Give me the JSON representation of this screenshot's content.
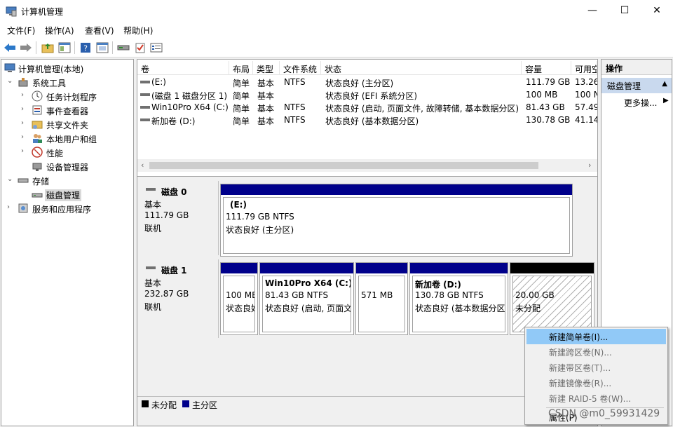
{
  "window": {
    "title": "计算机管理",
    "buttons": {
      "minimize": "—",
      "maximize": "☐",
      "close": "✕"
    }
  },
  "menu": [
    "文件(F)",
    "操作(A)",
    "查看(V)",
    "帮助(H)"
  ],
  "toolbar": {
    "icons": [
      "back-arrow-icon",
      "forward-arrow-icon",
      "up-folder-icon",
      "show-tree-icon",
      "help-icon",
      "console-icon",
      "connect-icon",
      "check-icon",
      "properties-icon"
    ]
  },
  "tree": {
    "root": "计算机管理(本地)",
    "system_tools": "系统工具",
    "task_scheduler": "任务计划程序",
    "event_viewer": "事件查看器",
    "shared_folders": "共享文件夹",
    "local_users": "本地用户和组",
    "performance": "性能",
    "device_manager": "设备管理器",
    "storage": "存储",
    "disk_management": "磁盘管理",
    "services": "服务和应用程序"
  },
  "volumes": {
    "headers": [
      "卷",
      "布局",
      "类型",
      "文件系统",
      "状态",
      "容量",
      "可用空"
    ],
    "rows": [
      {
        "name": "(E:)",
        "layout": "简单",
        "type": "基本",
        "fs": "NTFS",
        "status": "状态良好 (主分区)",
        "capacity": "111.79 GB",
        "free": "13.26"
      },
      {
        "name": "(磁盘 1 磁盘分区 1)",
        "layout": "简单",
        "type": "基本",
        "fs": "",
        "status": "状态良好 (EFI 系统分区)",
        "capacity": "100 MB",
        "free": "100 N"
      },
      {
        "name": "Win10Pro X64 (C:)",
        "layout": "简单",
        "type": "基本",
        "fs": "NTFS",
        "status": "状态良好 (启动, 页面文件, 故障转储, 基本数据分区)",
        "capacity": "81.43 GB",
        "free": "57.49"
      },
      {
        "name": "新加卷 (D:)",
        "layout": "简单",
        "type": "基本",
        "fs": "NTFS",
        "status": "状态良好 (基本数据分区)",
        "capacity": "130.78 GB",
        "free": "41.14"
      }
    ]
  },
  "disks": [
    {
      "name": "磁盘 0",
      "type": "基本",
      "size": "111.79 GB",
      "state": "联机",
      "partitions": [
        {
          "title": "(E:)",
          "size": "111.79 GB NTFS",
          "status": "状态良好 (主分区)"
        }
      ]
    },
    {
      "name": "磁盘 1",
      "type": "基本",
      "size": "232.87 GB",
      "state": "联机",
      "partitions": [
        {
          "title": "",
          "size": "100 MB",
          "status": "状态良好"
        },
        {
          "title": "Win10Pro X64  (C:)",
          "size": "81.43 GB NTFS",
          "status": "状态良好 (启动, 页面文"
        },
        {
          "title": "",
          "size": "571 MB",
          "status": ""
        },
        {
          "title": "新加卷  (D:)",
          "size": "130.78 GB NTFS",
          "status": "状态良好 (基本数据分区"
        },
        {
          "title": "",
          "size": "20.00 GB",
          "status": "未分配"
        }
      ]
    }
  ],
  "legend": {
    "unallocated": "未分配",
    "primary": "主分区",
    "unallocated_color": "#000000",
    "primary_color": "#00008b"
  },
  "actions": {
    "header": "操作",
    "section": "磁盘管理",
    "more": "更多操..."
  },
  "context_menu": [
    {
      "label": "新建简单卷(I)...",
      "enabled": true
    },
    {
      "label": "新建跨区卷(N)...",
      "enabled": false
    },
    {
      "label": "新建带区卷(T)...",
      "enabled": false
    },
    {
      "label": "新建镜像卷(R)...",
      "enabled": false
    },
    {
      "label": "新建 RAID-5 卷(W)...",
      "enabled": false
    },
    {
      "label": "属性(P)",
      "enabled": true
    }
  ],
  "watermark": "CSDN @m0_59931429"
}
